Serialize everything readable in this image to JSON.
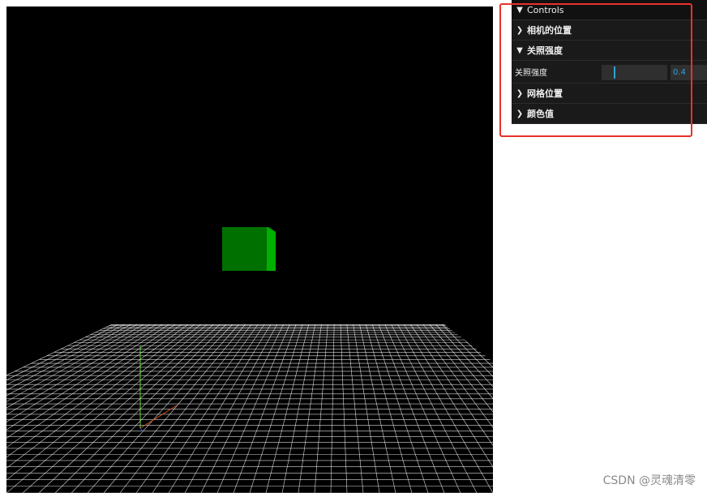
{
  "gui": {
    "title": "Controls",
    "folders": [
      {
        "label": "相机的位置",
        "expanded": false
      },
      {
        "label": "关照强度",
        "expanded": true
      },
      {
        "label": "网格位置",
        "expanded": false
      },
      {
        "label": "颜色值",
        "expanded": false
      }
    ],
    "light_control": {
      "label": "关照强度",
      "value": "0.4",
      "slider_fraction": 0.2
    }
  },
  "scene": {
    "background_color": "#000000",
    "cube_color": "#00a000",
    "grid_color": "#ffffff",
    "axes": [
      "x-axis",
      "y-axis",
      "z-axis"
    ]
  },
  "colors": {
    "panel_bg": "#1a1a1a",
    "accent": "#2fa1d6",
    "highlight_box": "#e8322a"
  },
  "watermark": "CSDN @灵魂清零"
}
